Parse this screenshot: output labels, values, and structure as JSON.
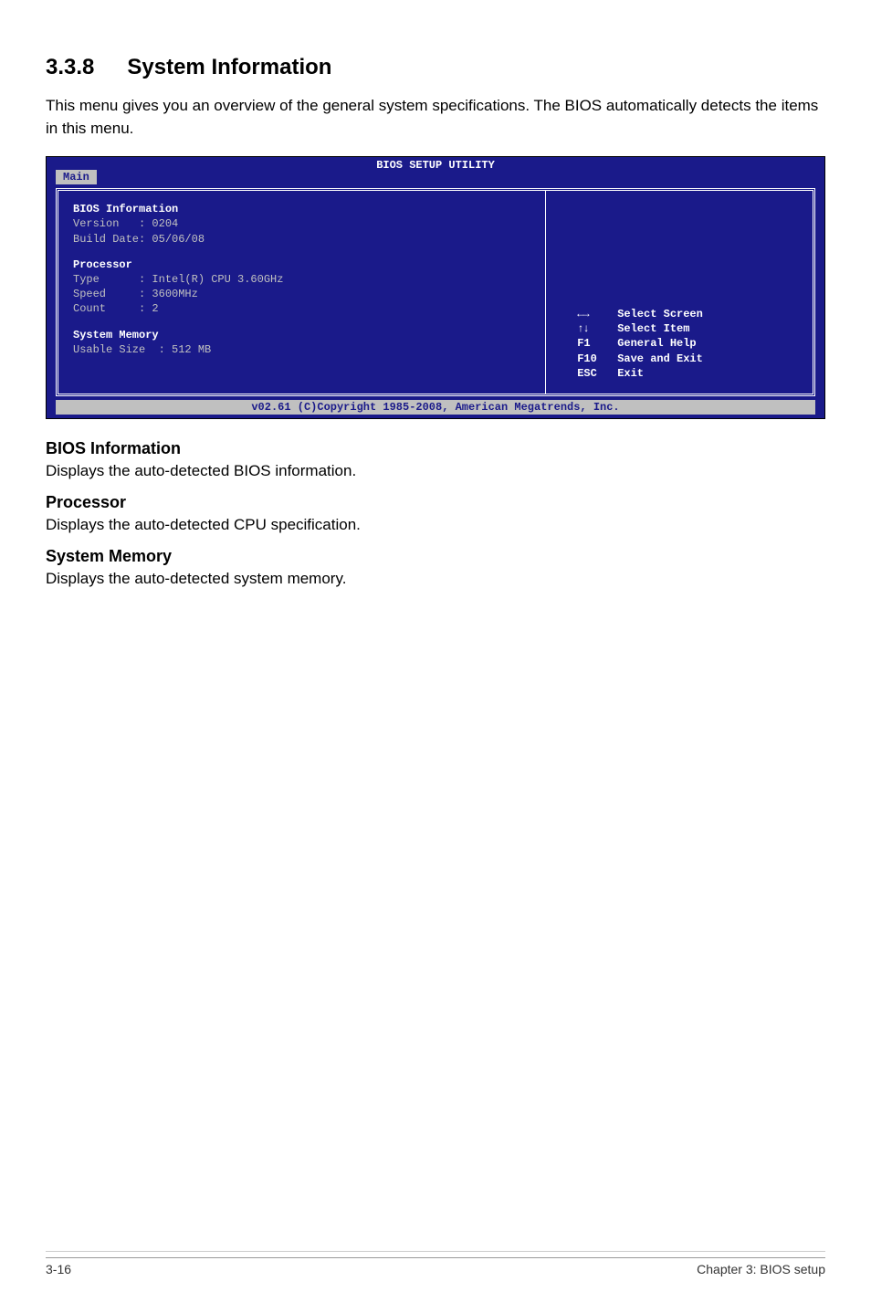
{
  "section": {
    "number": "3.3.8",
    "title": "System Information"
  },
  "intro": "This menu gives you an overview of the general system specifications. The BIOS automatically detects the items in this menu.",
  "bios": {
    "header": "BIOS SETUP UTILITY",
    "tab": "Main",
    "info": {
      "heading": "BIOS Information",
      "version_label": "Version   ",
      "version_value": ": 0204",
      "build_label": "Build Date",
      "build_value": ": 05/06/08"
    },
    "processor": {
      "heading": "Processor",
      "type_label": "Type      ",
      "type_value": ": Intel(R) CPU 3.60GHz",
      "speed_label": "Speed     ",
      "speed_value": ": 3600MHz",
      "count_label": "Count     ",
      "count_value": ": 2"
    },
    "memory": {
      "heading": "System Memory",
      "usable_label": "Usable Size  ",
      "usable_value": ": 512 MB"
    },
    "help": [
      {
        "key": "↔",
        "desc": "Select Screen"
      },
      {
        "key": "↕",
        "desc": "Select Item"
      },
      {
        "key": "F1",
        "desc": "General Help"
      },
      {
        "key": "F10",
        "desc": "Save and Exit"
      },
      {
        "key": "ESC",
        "desc": "Exit"
      }
    ],
    "footer": "v02.61 (C)Copyright 1985-2008, American Megatrends, Inc."
  },
  "sections": [
    {
      "heading": "BIOS Information",
      "text": "Displays the auto-detected BIOS information."
    },
    {
      "heading": "Processor",
      "text": "Displays the auto-detected CPU specification."
    },
    {
      "heading": "System Memory",
      "text": "Displays the auto-detected system memory."
    }
  ],
  "pagefoot": {
    "left": "3-16",
    "right": "Chapter 3: BIOS setup"
  }
}
